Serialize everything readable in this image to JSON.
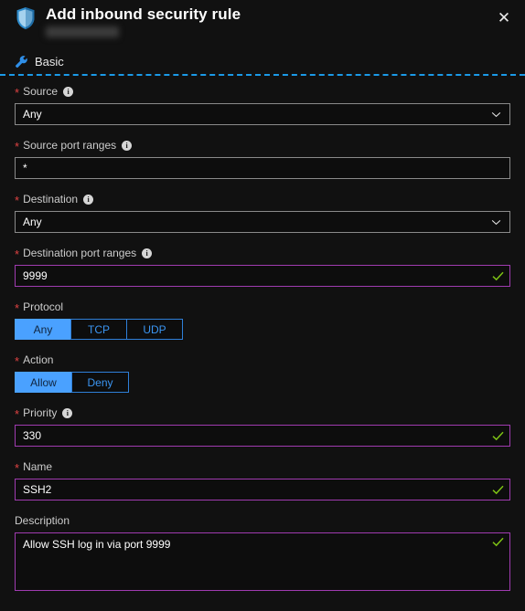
{
  "window": {
    "title": "Add inbound security rule",
    "subtitle": "",
    "shield_icon": "shield-icon",
    "close_label": "✕"
  },
  "tabs": [
    {
      "label": "Basic",
      "icon": "wrench-icon"
    }
  ],
  "colors": {
    "background": "#111111",
    "accent_blue": "#4aa1ff",
    "dashed_line": "#1b9ae8",
    "valid_border": "#a03bb0",
    "default_border": "#8a8a8a",
    "check_green": "#7ec314",
    "required_star": "#e04343"
  },
  "form": {
    "fields": [
      {
        "key": "source",
        "label": "Source",
        "required": true,
        "info": true,
        "type": "dropdown",
        "value": "Any",
        "validated": false
      },
      {
        "key": "source_port_ranges",
        "label": "Source port ranges",
        "required": true,
        "info": true,
        "type": "text",
        "value": "*",
        "validated": false
      },
      {
        "key": "destination",
        "label": "Destination",
        "required": true,
        "info": true,
        "type": "dropdown",
        "value": "Any",
        "validated": false
      },
      {
        "key": "destination_port_ranges",
        "label": "Destination port ranges",
        "required": true,
        "info": true,
        "type": "text",
        "value": "9999",
        "validated": true
      },
      {
        "key": "protocol",
        "label": "Protocol",
        "required": true,
        "info": false,
        "type": "segmented",
        "options": [
          "Any",
          "TCP",
          "UDP"
        ],
        "selected": "Any"
      },
      {
        "key": "action",
        "label": "Action",
        "required": true,
        "info": false,
        "type": "segmented",
        "options": [
          "Allow",
          "Deny"
        ],
        "selected": "Allow"
      },
      {
        "key": "priority",
        "label": "Priority",
        "required": true,
        "info": true,
        "type": "text",
        "value": "330",
        "validated": true
      },
      {
        "key": "name",
        "label": "Name",
        "required": true,
        "info": false,
        "type": "text",
        "value": "SSH2",
        "validated": true
      },
      {
        "key": "description",
        "label": "Description",
        "required": false,
        "info": false,
        "type": "textarea",
        "value": "Allow SSH log in via port 9999",
        "validated": true
      }
    ]
  }
}
